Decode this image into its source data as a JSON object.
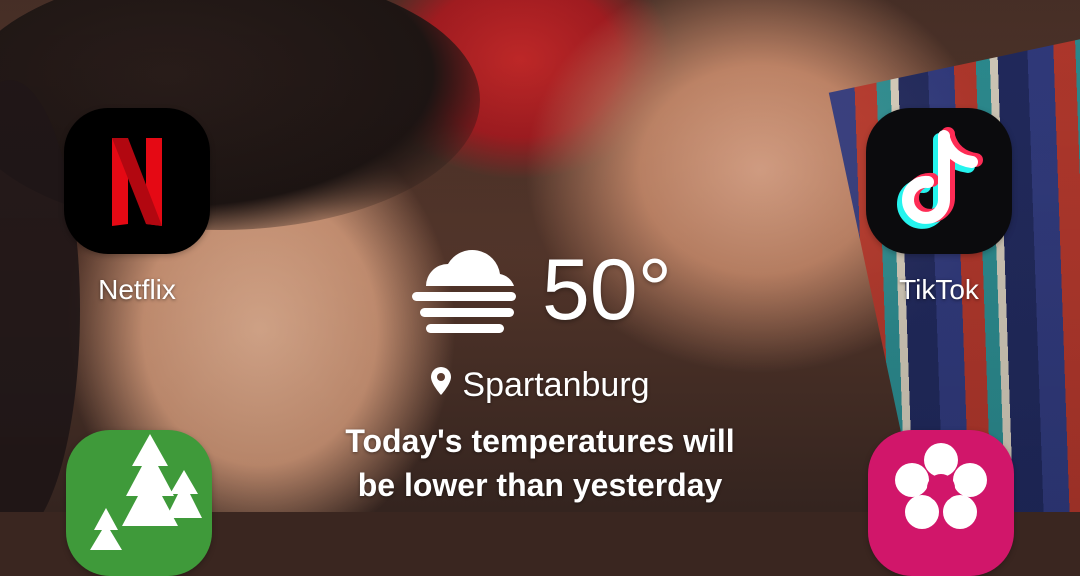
{
  "home_screen": {
    "apps": [
      {
        "label": "Netflix",
        "icon": "netflix-icon"
      },
      {
        "label": "TikTok",
        "icon": "tiktok-icon"
      },
      {
        "label": "",
        "icon": "forest-app-icon"
      },
      {
        "label": "",
        "icon": "flower-app-icon"
      }
    ]
  },
  "weather": {
    "condition_icon": "fog-cloud-icon",
    "temperature": "50°",
    "location_icon": "location-pin-icon",
    "location": "Spartanburg",
    "forecast_line1": "Today's temperatures will",
    "forecast_line2": "be lower than yesterday"
  },
  "colors": {
    "netflix_red": "#e50914",
    "tiktok_cyan": "#25f4ee",
    "tiktok_red": "#fe2c55",
    "green_app": "#3f9a3a",
    "pink_app": "#d1166a"
  }
}
